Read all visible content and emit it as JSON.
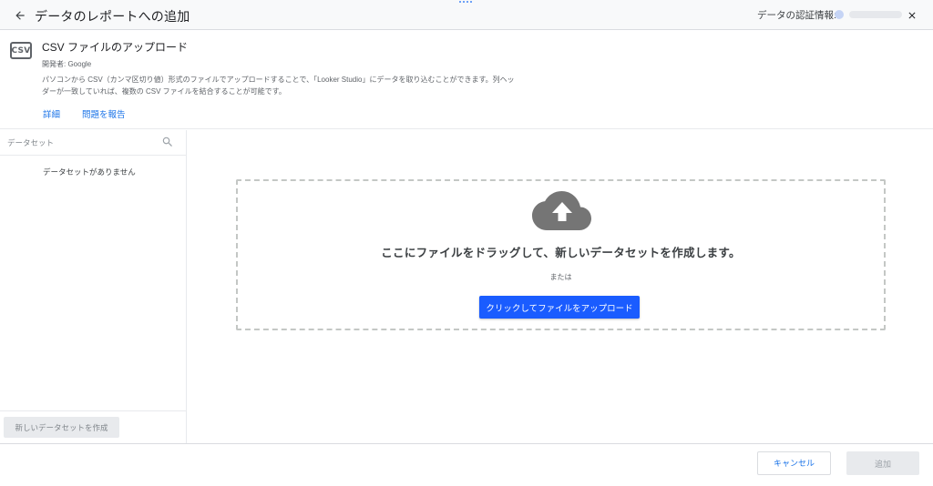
{
  "header": {
    "title": "データのレポートへの追加",
    "credentials_label": "データの認証情報:",
    "back_icon": "arrow-left-icon",
    "close_icon": "close-icon"
  },
  "connector": {
    "icon_text": "CSV",
    "title": "CSV ファイルのアップロード",
    "developer": "開発者: Google",
    "description": "パソコンから CSV（カンマ区切り値）形式のファイルでアップロードすることで、「Looker Studio」にデータを取り込むことができます。列ヘッダーが一致していれば、複数の CSV ファイルを結合することが可能です。",
    "links": {
      "details": "詳細",
      "report_issue": "問題を報告"
    }
  },
  "sidebar": {
    "search_placeholder": "データセット",
    "empty_message": "データセットがありません",
    "new_dataset_button": "新しいデータセットを作成"
  },
  "dropzone": {
    "main_text": "ここにファイルをドラッグして、新しいデータセットを作成します。",
    "or_text": "または",
    "upload_button": "クリックしてファイルをアップロード",
    "icon": "cloud-upload-icon"
  },
  "footer": {
    "cancel_button": "キャンセル",
    "add_button": "追加"
  },
  "colors": {
    "accent": "#1a73e8",
    "upload_button": "#1a5cff",
    "disabled_bg": "#e8eaed"
  }
}
